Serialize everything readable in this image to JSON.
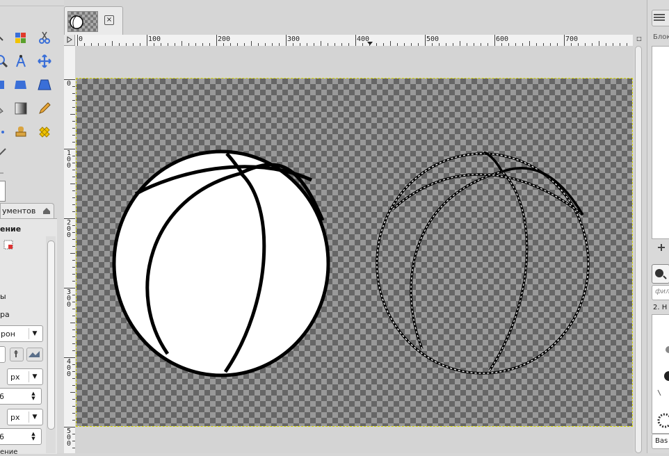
{
  "toolbox": {
    "tools": [
      {
        "name": "align-tool-icon"
      },
      {
        "name": "color-select-tool-icon"
      },
      {
        "name": "scissors-select-tool-icon"
      },
      {
        "name": "zoom-tool-icon"
      },
      {
        "name": "paths-tool-icon"
      },
      {
        "name": "move-tool-icon"
      },
      {
        "name": "flip-tool-icon"
      },
      {
        "name": "perspective-tool-icon"
      },
      {
        "name": "blend-tool-icon"
      },
      {
        "name": "pencil-tool-icon"
      },
      {
        "name": "clone-tool-icon"
      },
      {
        "name": "heal-tool-icon"
      }
    ],
    "options_tab_label": "ументов",
    "section_label": "ение",
    "label_a": "ы",
    "label_b": "ра",
    "mode_value": "рон",
    "unit1": "px",
    "value1": "6",
    "unit2": "px",
    "value2": "6",
    "bottom_label": "ение"
  },
  "image_tab": {
    "close_icon": "close-icon"
  },
  "ruler": {
    "h_labels": [
      "0",
      "100",
      "200",
      "300",
      "400",
      "500",
      "600",
      "700"
    ],
    "v_labels": [
      "0",
      "100",
      "200",
      "300",
      "400",
      "500"
    ]
  },
  "right_dock": {
    "channels_label": "Блок",
    "filter_placeholder": "фил",
    "brush_label": "2. Н",
    "brush_preset": "Bas"
  }
}
